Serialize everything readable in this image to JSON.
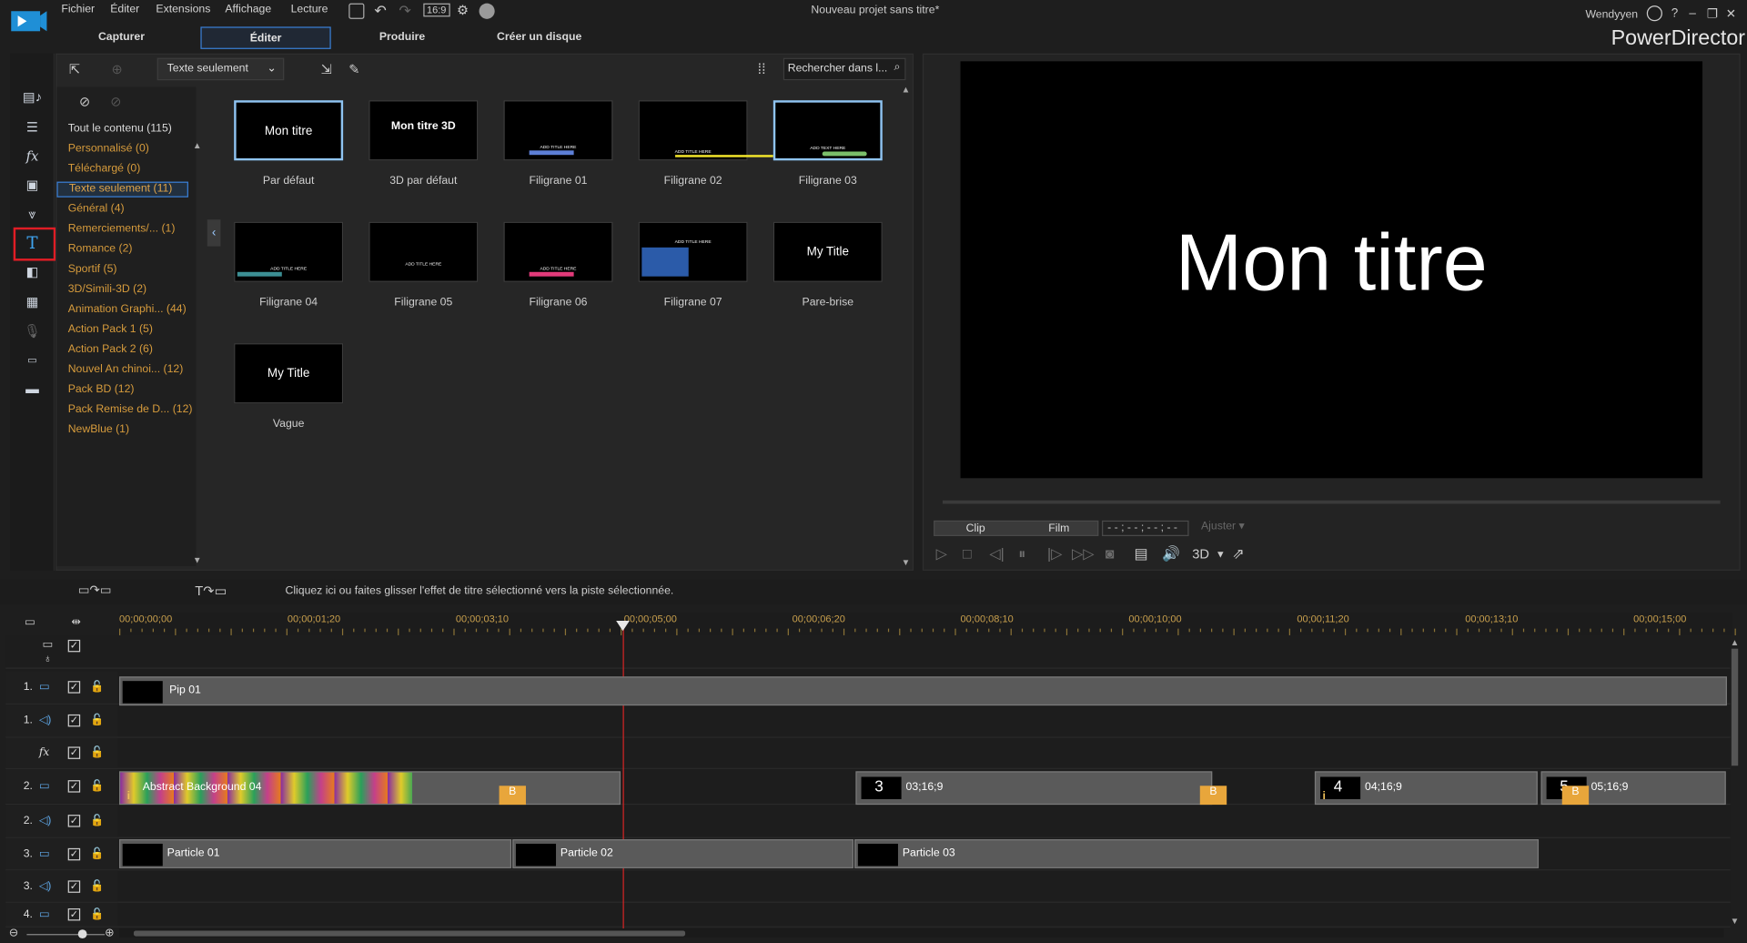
{
  "menu": {
    "items": [
      "Fichier",
      "Éditer",
      "Extensions",
      "Affichage",
      "Lecture"
    ],
    "aspect": "16:9",
    "doc_title": "Nouveau projet sans titre*",
    "user": "Wendyyen",
    "help": "?",
    "brand": "PowerDirector"
  },
  "modes": [
    "Capturer",
    "Éditer",
    "Produire",
    "Créer un disque"
  ],
  "library": {
    "filter": "Texte seulement",
    "search_placeholder": "Rechercher dans l...",
    "categories": [
      {
        "label": "Tout le contenu (115)",
        "style": "white"
      },
      {
        "label": "Personnalisé  (0)",
        "style": "normal"
      },
      {
        "label": "Téléchargé  (0)",
        "style": "normal"
      },
      {
        "label": "Texte seulement  (11)",
        "style": "selected"
      },
      {
        "label": "Général  (4)",
        "style": "normal"
      },
      {
        "label": "Remerciements/...  (1)",
        "style": "normal"
      },
      {
        "label": "Romance  (2)",
        "style": "normal"
      },
      {
        "label": "Sportif  (5)",
        "style": "normal"
      },
      {
        "label": "3D/Simili-3D  (2)",
        "style": "normal"
      },
      {
        "label": "Animation Graphi...  (44)",
        "style": "normal"
      },
      {
        "label": "Action Pack 1  (5)",
        "style": "normal"
      },
      {
        "label": "Action Pack 2  (6)",
        "style": "normal"
      },
      {
        "label": "Nouvel An chinoi...  (12)",
        "style": "normal"
      },
      {
        "label": "Pack BD  (12)",
        "style": "normal"
      },
      {
        "label": "Pack Remise de D...  (12)",
        "style": "normal"
      },
      {
        "label": "NewBlue  (1)",
        "style": "normal"
      }
    ],
    "templates": [
      {
        "label": "Par défaut",
        "preview": "Mon titre",
        "selected": true
      },
      {
        "label": "3D par défaut",
        "preview": "Mon titre 3D",
        "selected": false
      },
      {
        "label": "Filigrane 01",
        "preview": "ADD TITLE HERE",
        "selected": false
      },
      {
        "label": "Filigrane 02",
        "preview": "ADD TITLE HERE",
        "selected": false
      },
      {
        "label": "Filigrane 03",
        "preview": "ADD TEXT HERE",
        "selected": true
      },
      {
        "label": "Filigrane 04",
        "preview": "ADD TITLE HERE",
        "selected": false
      },
      {
        "label": "Filigrane 05",
        "preview": "ADD TITLE HERE",
        "selected": false
      },
      {
        "label": "Filigrane 06",
        "preview": "ADD TITLE HERE",
        "selected": false
      },
      {
        "label": "Filigrane 07",
        "preview": "ADD TITLE HERE",
        "selected": false
      },
      {
        "label": "Pare-brise",
        "preview": "My Title",
        "selected": false
      },
      {
        "label": "Vague",
        "preview": "My Title",
        "selected": false
      }
    ]
  },
  "preview": {
    "title": "Mon titre",
    "clip_label": "Clip",
    "film_label": "Film",
    "timecode": "- - ; - - ; - - ; - -",
    "fit_label": "Ajuster",
    "mode_3d": "3D"
  },
  "timeline": {
    "hint": "Cliquez ici ou faites glisser l'effet de titre sélectionné vers la piste sélectionnée.",
    "ruler": [
      "00;00;00;00",
      "00;00;01;20",
      "00;00;03;10",
      "00;00;05;00",
      "00;00;06;20",
      "00;00;08;10",
      "00;00;10;00",
      "00;00;11;20",
      "00;00;13;10",
      "00;00;15;00"
    ],
    "tracks": [
      {
        "num": "1.",
        "type": "video"
      },
      {
        "num": "1.",
        "type": "audio"
      },
      {
        "num": "",
        "type": "fx"
      },
      {
        "num": "2.",
        "type": "video"
      },
      {
        "num": "2.",
        "type": "audio"
      },
      {
        "num": "3.",
        "type": "video"
      },
      {
        "num": "3.",
        "type": "audio"
      },
      {
        "num": "4.",
        "type": "video"
      }
    ],
    "clips": {
      "pip": "Pip 01",
      "abstract": "Abstract Background 04",
      "t3": "3",
      "t3_time": "03;16;9",
      "t4": "4",
      "t4_time": "04;16;9",
      "t5": "5",
      "t5_time": "05;16;9",
      "b_label": "B",
      "i_label": "i",
      "particle1": "Particle 01",
      "particle2": "Particle 02",
      "particle3": "Particle 03"
    }
  },
  "colors": {
    "accent": "#3a7fd5",
    "category": "#d69b3c",
    "highlight": "#e01d25",
    "playhead": "#d42525"
  }
}
